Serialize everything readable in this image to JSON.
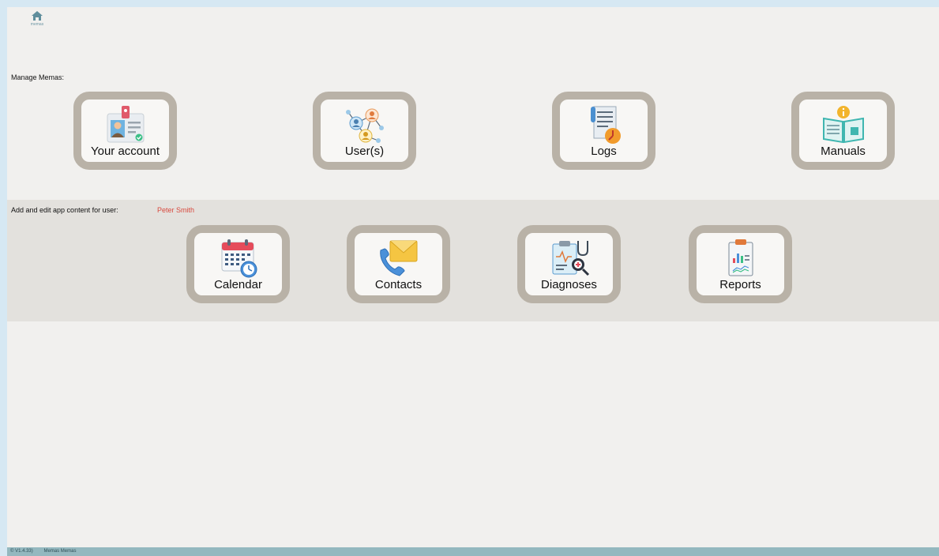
{
  "header": {
    "home_label": "memas"
  },
  "manage": {
    "title": "Manage Memas:",
    "tiles": [
      {
        "label": "Your account",
        "icon": "id-card-icon"
      },
      {
        "label": "User(s)",
        "icon": "users-network-icon"
      },
      {
        "label": "Logs",
        "icon": "log-clock-icon"
      },
      {
        "label": "Manuals",
        "icon": "manual-book-icon"
      }
    ]
  },
  "user_content": {
    "title": "Add and edit app content for user:",
    "user_name": "Peter Smith",
    "tiles": [
      {
        "label": "Calendar",
        "icon": "calendar-icon"
      },
      {
        "label": "Contacts",
        "icon": "contacts-icon"
      },
      {
        "label": "Diagnoses",
        "icon": "diagnoses-icon"
      },
      {
        "label": "Reports",
        "icon": "reports-icon"
      }
    ]
  },
  "status_bar": {
    "version": "© V1.4.33)",
    "app_name": "Memas Memas"
  },
  "colors": {
    "accent_name": "#d84a3f",
    "tile_border": "#b9b2a7",
    "status_bar": "#94b8bf",
    "page_bg": "#d6e8f3"
  }
}
